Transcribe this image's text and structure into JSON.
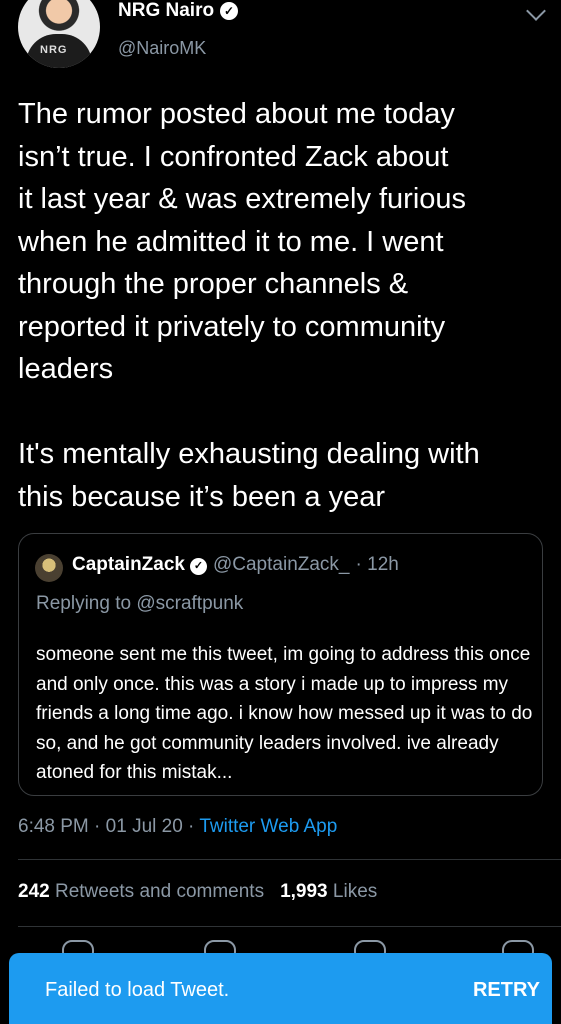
{
  "author": {
    "name": "NRG Nairo",
    "handle": "@NairoMK",
    "avatar_text": "NRG"
  },
  "tweet": {
    "text": "The rumor posted about me today\nisn’t true. I confronted Zack about\nit last year & was extremely furious\nwhen he admitted it to me. I went\nthrough the proper channels &\nreported it privately to community\nleaders\n\nIt's mentally exhausting dealing with\nthis because it’s been a year"
  },
  "quoted": {
    "name": "CaptainZack",
    "handle": "@CaptainZack_",
    "time": "· 12h",
    "replying_to": "Replying to @scraftpunk",
    "text": "someone sent me this tweet, im going to address this once and only once. this was a story i made up to impress my friends a long time ago. i know how messed up it was to do so, and he got community leaders involved. ive already atoned for this mistak..."
  },
  "meta": {
    "time": "6:48 PM",
    "date": "· 01 Jul 20 ·",
    "source": "Twitter Web App"
  },
  "stats": {
    "retweets_count": "242",
    "retweets_label": "Retweets and comments",
    "likes_count": "1,993",
    "likes_label": "Likes"
  },
  "toast": {
    "message": "Failed to load Tweet.",
    "action": "RETRY"
  },
  "colors": {
    "background": "#000000",
    "accent": "#1d9bf0",
    "secondary_text": "#8b98a5"
  }
}
